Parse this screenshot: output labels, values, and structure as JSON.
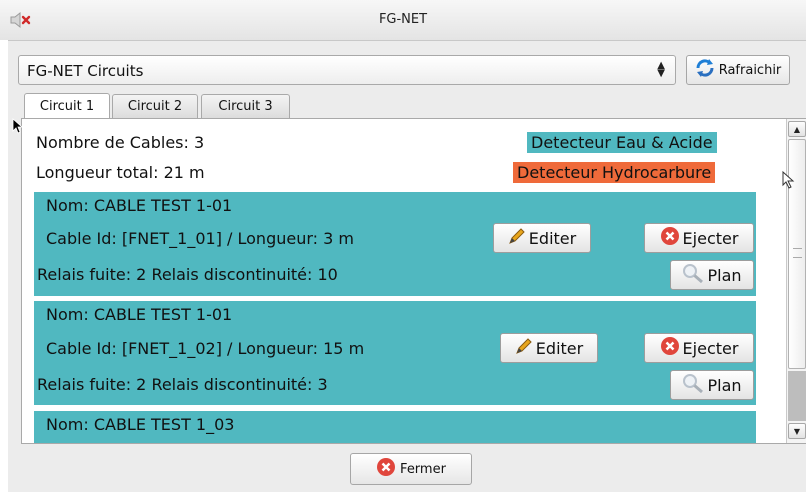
{
  "window": {
    "title": "FG-NET"
  },
  "toolbar": {
    "circuit_select_value": "FG-NET Circuits",
    "refresh_label": "Rafraichir"
  },
  "tabs": [
    {
      "label": "Circuit 1",
      "active": true
    },
    {
      "label": "Circuit 2",
      "active": false
    },
    {
      "label": "Circuit 3",
      "active": false
    }
  ],
  "summary": {
    "cable_count": "Nombre de Cables: 3",
    "total_length": "Longueur total: 21 m",
    "detector_water": "Detecteur Eau & Acide",
    "detector_hydro": "Detecteur Hydrocarbure"
  },
  "cables": [
    {
      "name": "Nom: CABLE TEST 1-01",
      "id_length": "Cable Id: [FNET_1_01] / Longueur: 3 m",
      "relays": "Relais fuite: 2  Relais discontinuité: 10",
      "edit_label": "Editer",
      "eject_label": "Ejecter",
      "plan_label": "Plan"
    },
    {
      "name": "Nom: CABLE TEST 1-01",
      "id_length": "Cable Id: [FNET_1_02] / Longueur: 15 m",
      "relays": "Relais fuite: 2  Relais discontinuité: 3",
      "edit_label": "Editer",
      "eject_label": "Ejecter",
      "plan_label": "Plan"
    },
    {
      "name": "Nom: CABLE TEST 1_03"
    }
  ],
  "footer": {
    "close_label": "Fermer"
  },
  "colors": {
    "teal": "#50b8c0",
    "orange": "#ef6a3a",
    "eject_red": "#e0463c"
  },
  "icons": [
    "speaker-muted-icon",
    "refresh-icon",
    "pencil-icon",
    "eject-icon",
    "magnifier-icon",
    "close-icon",
    "select-arrows-icon"
  ]
}
